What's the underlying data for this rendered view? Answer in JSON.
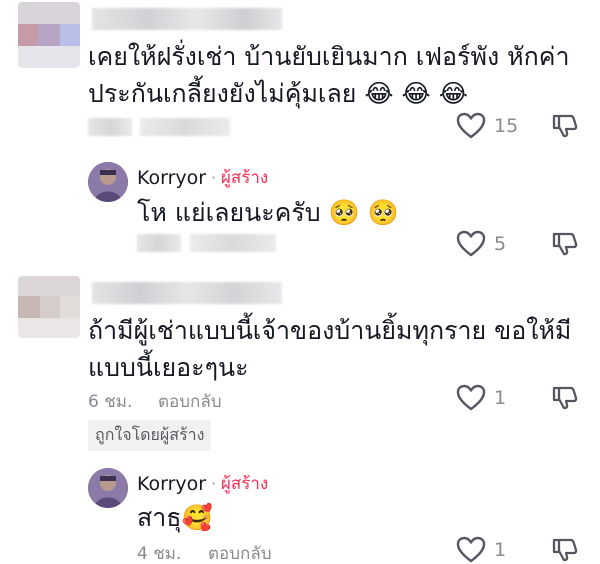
{
  "comments": [
    {
      "text_line1": "เคยให้ฝรั่งเช่า บ้านยับเยินมาก เฟอร์พัง หักค่า",
      "text_line2": "ประกันเกลี้ยงยังไม่คุ้มเลย",
      "emojis": "😂 😂 😂",
      "likes": "15",
      "replies": [
        {
          "author": "Korryor",
          "dot": "·",
          "tag": "ผู้สร้าง",
          "text": "โห แย่เลยนะครับ",
          "emojis": "🥺 🥺",
          "likes": "5"
        }
      ]
    },
    {
      "text_line1": "ถ้ามีผู้เช่าแบบนี้เจ้าของบ้านยิ้มทุกราย ขอให้มี",
      "text_line2": "แบบนี้เยอะๆนะ",
      "time": "6 ชม.",
      "reply_label": "ตอบกลับ",
      "likes": "1",
      "liked_by_creator": "ถูกใจโดยผู้สร้าง",
      "replies": [
        {
          "author": "Korryor",
          "dot": "·",
          "tag": "ผู้สร้าง",
          "text": "สาธุ",
          "emojis": "🥰",
          "time": "4 ชม.",
          "reply_label": "ตอบกลับ",
          "likes": "1"
        }
      ]
    }
  ],
  "icons": {
    "like": "heart-outline-icon",
    "dislike": "thumbs-down-icon"
  },
  "colors": {
    "creator": "#fe2c55",
    "muted": "#8a8b91",
    "text": "#161823"
  }
}
